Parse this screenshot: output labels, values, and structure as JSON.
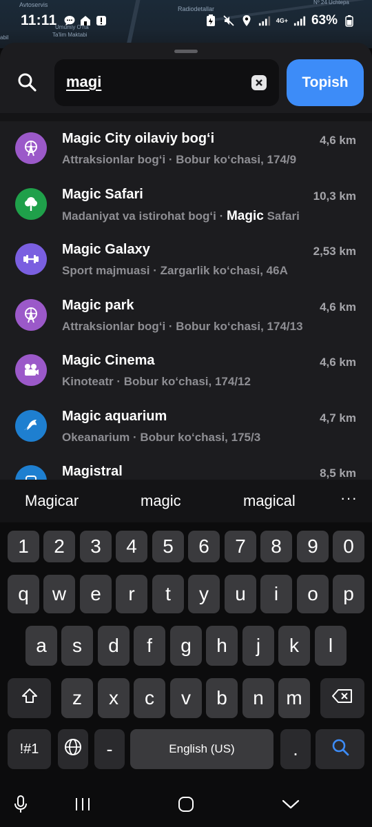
{
  "status_bar": {
    "time": "11:11",
    "battery": "63%",
    "network": "4G+"
  },
  "map": {
    "labels": [
      "Avtoservis",
      "Radiodetallar",
      "Umumiy O'rta",
      "Ta'lim Maktabi",
      "Nº 24 Uchtepa",
      "abil"
    ]
  },
  "search": {
    "value": "magi",
    "button_label": "Topish"
  },
  "results": [
    {
      "title": "Magic City oilaviy bog‘i",
      "distance": "4,6 km",
      "subtitle": "Attraksionlar bog‘i · Bobur ko‘chasi, 174/9",
      "icon": "ferris-wheel-icon",
      "color": "#9b59c9"
    },
    {
      "title": "Magic Safari",
      "distance": "10,3 km",
      "subtitle_prefix": "Madaniyat va istirohat bog‘i · ",
      "subtitle_highlight": "Magic",
      "subtitle_suffix": " Safari",
      "icon": "tree-icon",
      "color": "#1fa04a"
    },
    {
      "title": "Magic Galaxy",
      "distance": "2,53 km",
      "subtitle": "Sport majmuasi · Zargarlik ko‘chasi, 46A",
      "icon": "dumbbell-icon",
      "color": "#7a5fe0"
    },
    {
      "title": "Magic park",
      "distance": "4,6 km",
      "subtitle": "Attraksionlar bog‘i · Bobur ko‘chasi, 174/13",
      "icon": "ferris-wheel-icon",
      "color": "#9b59c9"
    },
    {
      "title": "Magic Cinema",
      "distance": "4,6 km",
      "subtitle": "Kinoteatr · Bobur ko‘chasi, 174/12",
      "icon": "film-camera-icon",
      "color": "#9b59c9"
    },
    {
      "title": "Magic aquarium",
      "distance": "4,7 km",
      "subtitle": "Okeanarium · Bobur ko‘chasi, 175/3",
      "icon": "dolphin-icon",
      "color": "#1e7fd0"
    },
    {
      "title": "Magistral",
      "distance": "8,5 km",
      "subtitle": "",
      "icon": "place-icon",
      "color": "#1e7fd0"
    }
  ],
  "keyboard": {
    "suggestions": [
      "Magicar",
      "magic",
      "magical"
    ],
    "more": "···",
    "numbers": [
      "1",
      "2",
      "3",
      "4",
      "5",
      "6",
      "7",
      "8",
      "9",
      "0"
    ],
    "row1": [
      "q",
      "w",
      "e",
      "r",
      "t",
      "y",
      "u",
      "i",
      "o",
      "p"
    ],
    "row2": [
      "a",
      "s",
      "d",
      "f",
      "g",
      "h",
      "j",
      "k",
      "l"
    ],
    "row3": [
      "z",
      "x",
      "c",
      "v",
      "b",
      "n",
      "m"
    ],
    "symbols_label": "!#1",
    "dash_label": "-",
    "space_label": "English (US)",
    "period_label": "."
  }
}
